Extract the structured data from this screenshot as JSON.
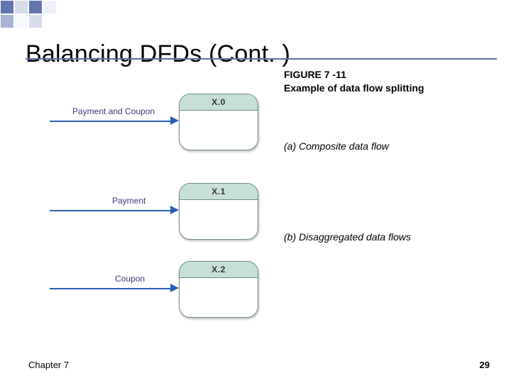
{
  "title": "Balancing DFDs (Cont. )",
  "figure": {
    "number": "FIGURE 7 -11",
    "description": "Example of data flow splitting"
  },
  "annotations": {
    "a": "(a) Composite data flow",
    "b": "(b) Disaggregated data flows"
  },
  "flows": [
    {
      "arrow_label": "Payment and Coupon",
      "process_id": "X.0"
    },
    {
      "arrow_label": "Payment",
      "process_id": "X.1"
    },
    {
      "arrow_label": "Coupon",
      "process_id": "X.2"
    }
  ],
  "footer": {
    "chapter": "Chapter 7",
    "page": "29"
  }
}
